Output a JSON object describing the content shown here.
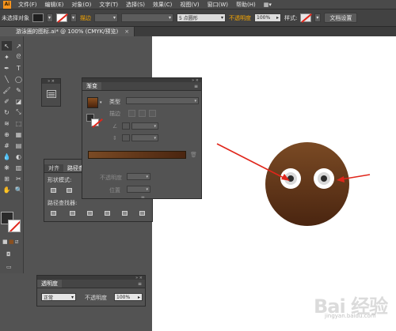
{
  "menubar": {
    "logo": "Ai",
    "items": [
      "文件(F)",
      "编辑(E)",
      "对象(O)",
      "文字(T)",
      "选择(S)",
      "效果(C)",
      "视图(V)",
      "窗口(W)",
      "帮助(H)"
    ]
  },
  "control_bar": {
    "selection_label": "未选择对象",
    "stroke_label": "描边",
    "brush_value": "5 点圆形",
    "opacity_label": "不透明度",
    "opacity_value": "100%",
    "style_label": "样式:",
    "doc_setup_button": "文档设置"
  },
  "tab": {
    "title": "游泳圈的图标.ai* @ 100% (CMYK/预览)",
    "close": "×"
  },
  "gradient_panel": {
    "tab": "渐变",
    "type_label": "类型",
    "stroke_label": "描边",
    "angle_icon": "angle-icon",
    "ratio_icon": "ratio-icon",
    "opacity_label": "不透明度",
    "location_label": "位置",
    "colors": {
      "start": "#7a4a24",
      "end": "#4a2510"
    }
  },
  "pathfinder_panel": {
    "tabs": [
      "对齐",
      "路径查找器"
    ],
    "shape_modes_label": "形状模式:",
    "pathfinders_label": "路径查找器:"
  },
  "transparency_panel": {
    "tab": "透明度",
    "blend_mode": "正常",
    "opacity_label": "不透明度",
    "opacity_value": "100%"
  },
  "artwork": {
    "face_color_top": "#7a4a24",
    "face_color_bottom": "#4a2510",
    "arrow_color": "#e0261b"
  },
  "watermark": {
    "text": "Bai 经验",
    "sub": "jingyan.baidu.com"
  }
}
